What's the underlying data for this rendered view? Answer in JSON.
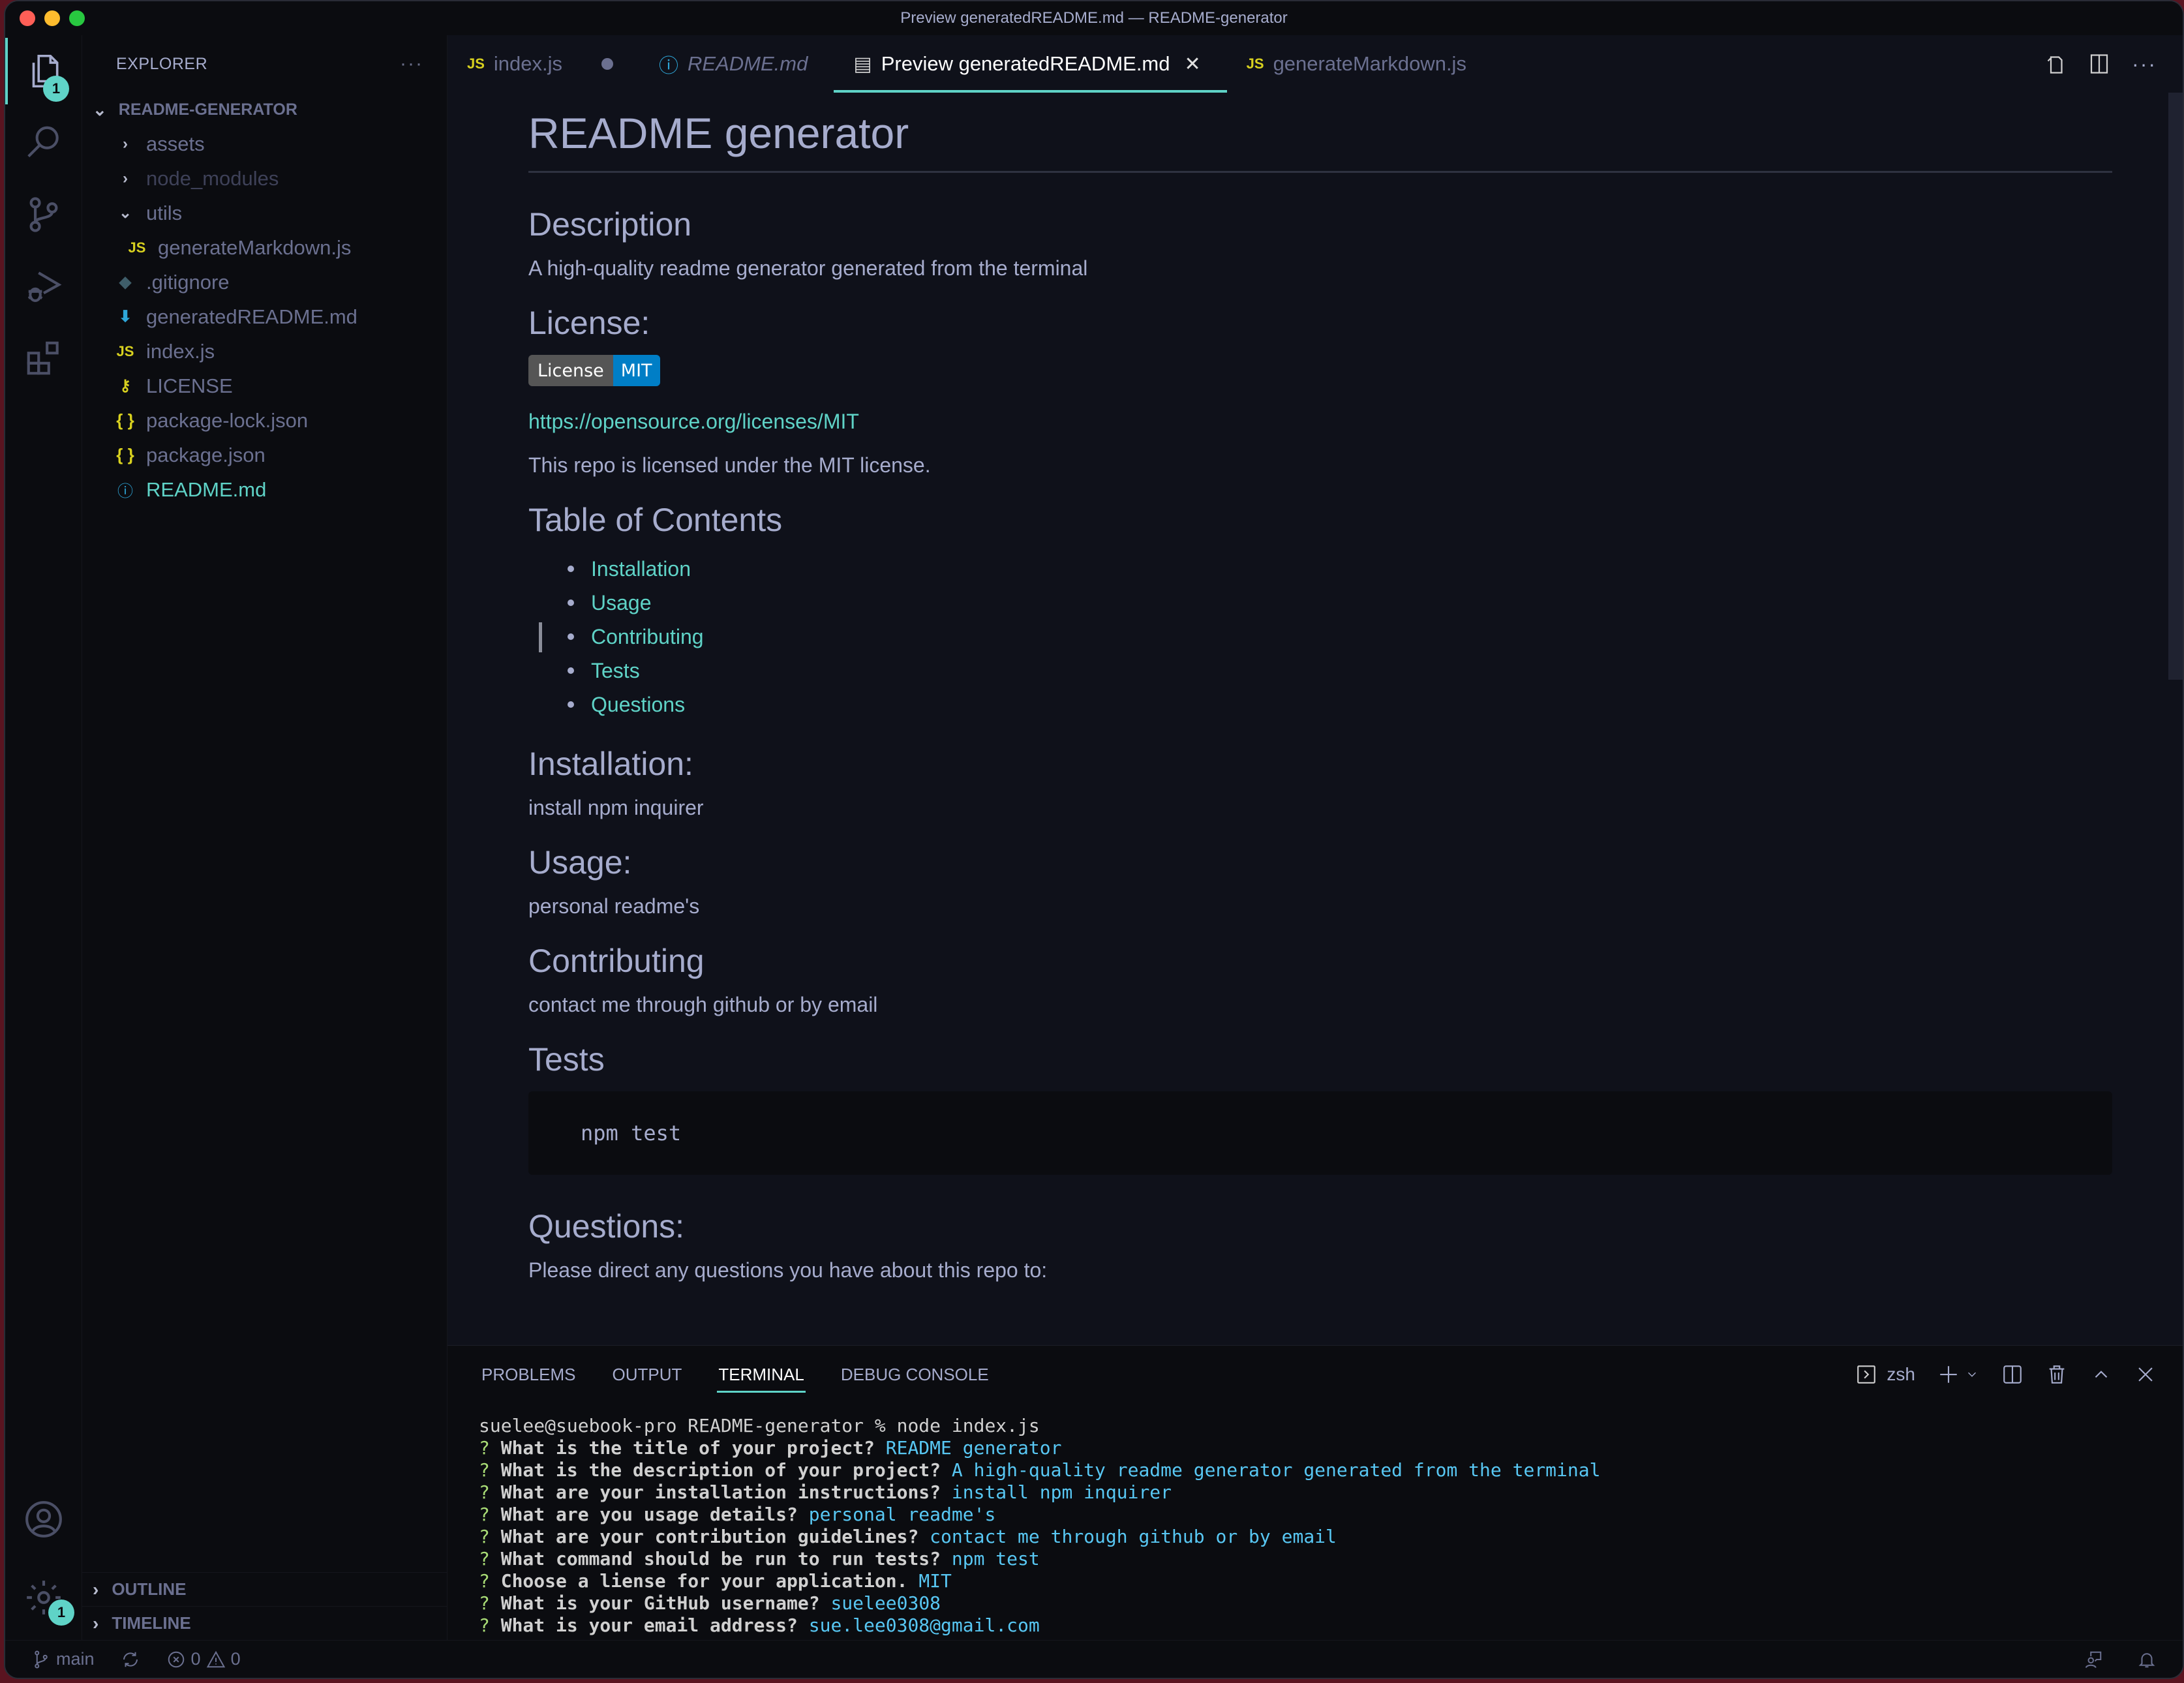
{
  "window": {
    "title": "Preview generatedREADME.md — README-generator"
  },
  "activity_bar": {
    "explorer_badge": "1",
    "settings_badge": "1"
  },
  "sidebar": {
    "title": "EXPLORER",
    "more_label": "···",
    "root": "README-GENERATOR",
    "items": [
      {
        "label": "assets",
        "type": "folder",
        "state": "collapsed"
      },
      {
        "label": "node_modules",
        "type": "folder",
        "state": "collapsed"
      },
      {
        "label": "utils",
        "type": "folder",
        "state": "expanded"
      },
      {
        "label": "generateMarkdown.js",
        "type": "js",
        "icon": "JS"
      },
      {
        "label": ".gitignore",
        "type": "git"
      },
      {
        "label": "generatedREADME.md",
        "type": "md-download"
      },
      {
        "label": "index.js",
        "type": "js",
        "icon": "JS"
      },
      {
        "label": "LICENSE",
        "type": "license"
      },
      {
        "label": "package-lock.json",
        "type": "json",
        "icon": "{ }"
      },
      {
        "label": "package.json",
        "type": "json",
        "icon": "{ }"
      },
      {
        "label": "README.md",
        "type": "info"
      }
    ],
    "sections": [
      "OUTLINE",
      "TIMELINE"
    ]
  },
  "tabs": [
    {
      "label": "index.js",
      "icon": "JS",
      "dirty": true
    },
    {
      "label": "README.md",
      "icon": "info"
    },
    {
      "label": "Preview generatedREADME.md",
      "icon": "preview",
      "active": true
    },
    {
      "label": "generateMarkdown.js",
      "icon": "JS"
    }
  ],
  "preview": {
    "title": "README generator",
    "description_heading": "Description",
    "description": "A high-quality readme generator generated from the terminal",
    "license_heading": "License:",
    "badge_left": "License",
    "badge_right": "MIT",
    "license_link": "https://opensource.org/licenses/MIT",
    "license_text": "This repo is licensed under the MIT license.",
    "toc_heading": "Table of Contents",
    "toc": [
      "Installation",
      "Usage",
      "Contributing",
      "Tests",
      "Questions"
    ],
    "installation_heading": "Installation:",
    "installation": "install npm inquirer",
    "usage_heading": "Usage:",
    "usage": "personal readme's",
    "contributing_heading": "Contributing",
    "contributing": "contact me through github or by email",
    "tests_heading": "Tests",
    "tests_code": "npm test",
    "questions_heading": "Questions:",
    "questions_text": "Please direct any questions you have about this repo to:"
  },
  "panel": {
    "tabs": [
      "PROBLEMS",
      "OUTPUT",
      "TERMINAL",
      "DEBUG CONSOLE"
    ],
    "active_tab": "TERMINAL",
    "shell": "zsh",
    "terminal": {
      "prompt": "suelee@suebook-pro README-generator % node index.js",
      "lines": [
        {
          "q": "What is the title of your project?",
          "a": "README generator"
        },
        {
          "q": "What is the description of your project?",
          "a": "A high-quality readme generator generated from the terminal"
        },
        {
          "q": "What are your installation instructions?",
          "a": "install npm inquirer"
        },
        {
          "q": "What are you usage details?",
          "a": "personal readme's"
        },
        {
          "q": "What are your contribution guidelines?",
          "a": "contact me through github or by email"
        },
        {
          "q": "What command should be run to run tests?",
          "a": "npm test"
        },
        {
          "q": "Choose a liense for your application.",
          "a": "MIT"
        },
        {
          "q": "What is your GitHub username?",
          "a": "suelee0308"
        },
        {
          "q": "What is your email address?",
          "a": "sue.lee0308@gmail.com"
        }
      ]
    }
  },
  "statusbar": {
    "branch": "main",
    "errors": "0",
    "warnings": "0"
  },
  "colors": {
    "accent": "#5fd3c7",
    "editor_bg": "#0f111a",
    "sidebar_bg": "#0b0c10",
    "text": "#a6accd",
    "js_icon": "#d8d11f",
    "terminal_answer": "#58c7f3",
    "terminal_question_mark": "#a9dc76"
  }
}
